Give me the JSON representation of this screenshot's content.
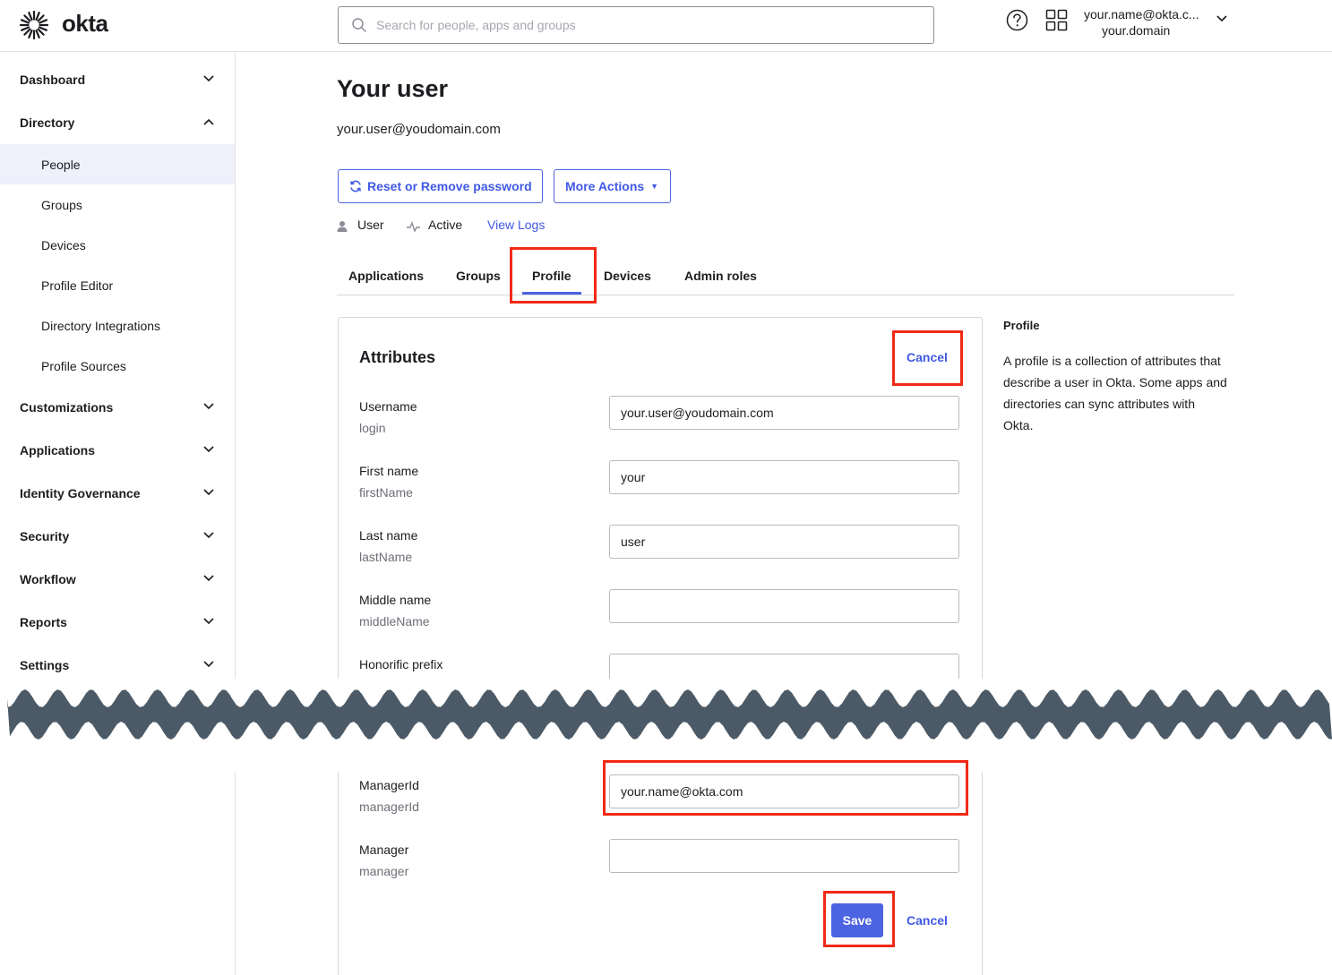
{
  "brand": {
    "name": "okta",
    "accent": "#4c64e1",
    "highlight": "#f02a17"
  },
  "header": {
    "search_placeholder": "Search for people, apps and groups",
    "user_name": "your.name@okta.c...",
    "user_domain": "your.domain",
    "icons": [
      "search-icon",
      "help-icon",
      "apps-grid-icon",
      "chevron-down-icon"
    ]
  },
  "sidebar": {
    "dashboard": "Dashboard",
    "directory": "Directory",
    "directory_items": [
      "People",
      "Groups",
      "Devices",
      "Profile Editor",
      "Directory Integrations",
      "Profile Sources"
    ],
    "active_item": "People",
    "sections": [
      "Customizations",
      "Applications",
      "Identity Governance",
      "Security",
      "Workflow",
      "Reports",
      "Settings"
    ]
  },
  "user": {
    "title": "Your user",
    "email": "your.user@youdomain.com",
    "reset_button": "Reset or Remove password",
    "more_actions_button": "More Actions",
    "type": "User",
    "status": "Active",
    "view_logs": "View Logs"
  },
  "tabs": {
    "items": [
      "Applications",
      "Groups",
      "Profile",
      "Devices",
      "Admin roles"
    ],
    "active": "Profile"
  },
  "attributes": {
    "title": "Attributes",
    "cancel_top": "Cancel",
    "fields": [
      {
        "label": "Username",
        "variable": "login",
        "value": "your.user@youdomain.com"
      },
      {
        "label": "First name",
        "variable": "firstName",
        "value": "your"
      },
      {
        "label": "Last name",
        "variable": "lastName",
        "value": "user"
      },
      {
        "label": "Middle name",
        "variable": "middleName",
        "value": ""
      },
      {
        "label": "Honorific prefix",
        "variable": "",
        "value": ""
      },
      {
        "label": "ManagerId",
        "variable": "managerId",
        "value": "your.name@okta.com"
      },
      {
        "label": "Manager",
        "variable": "manager",
        "value": ""
      }
    ],
    "save": "Save",
    "cancel_bottom": "Cancel"
  },
  "help": {
    "title": "Profile",
    "text": "A profile is a collection of attributes that describe a user in Okta. Some apps and directories can sync attributes with Okta."
  }
}
